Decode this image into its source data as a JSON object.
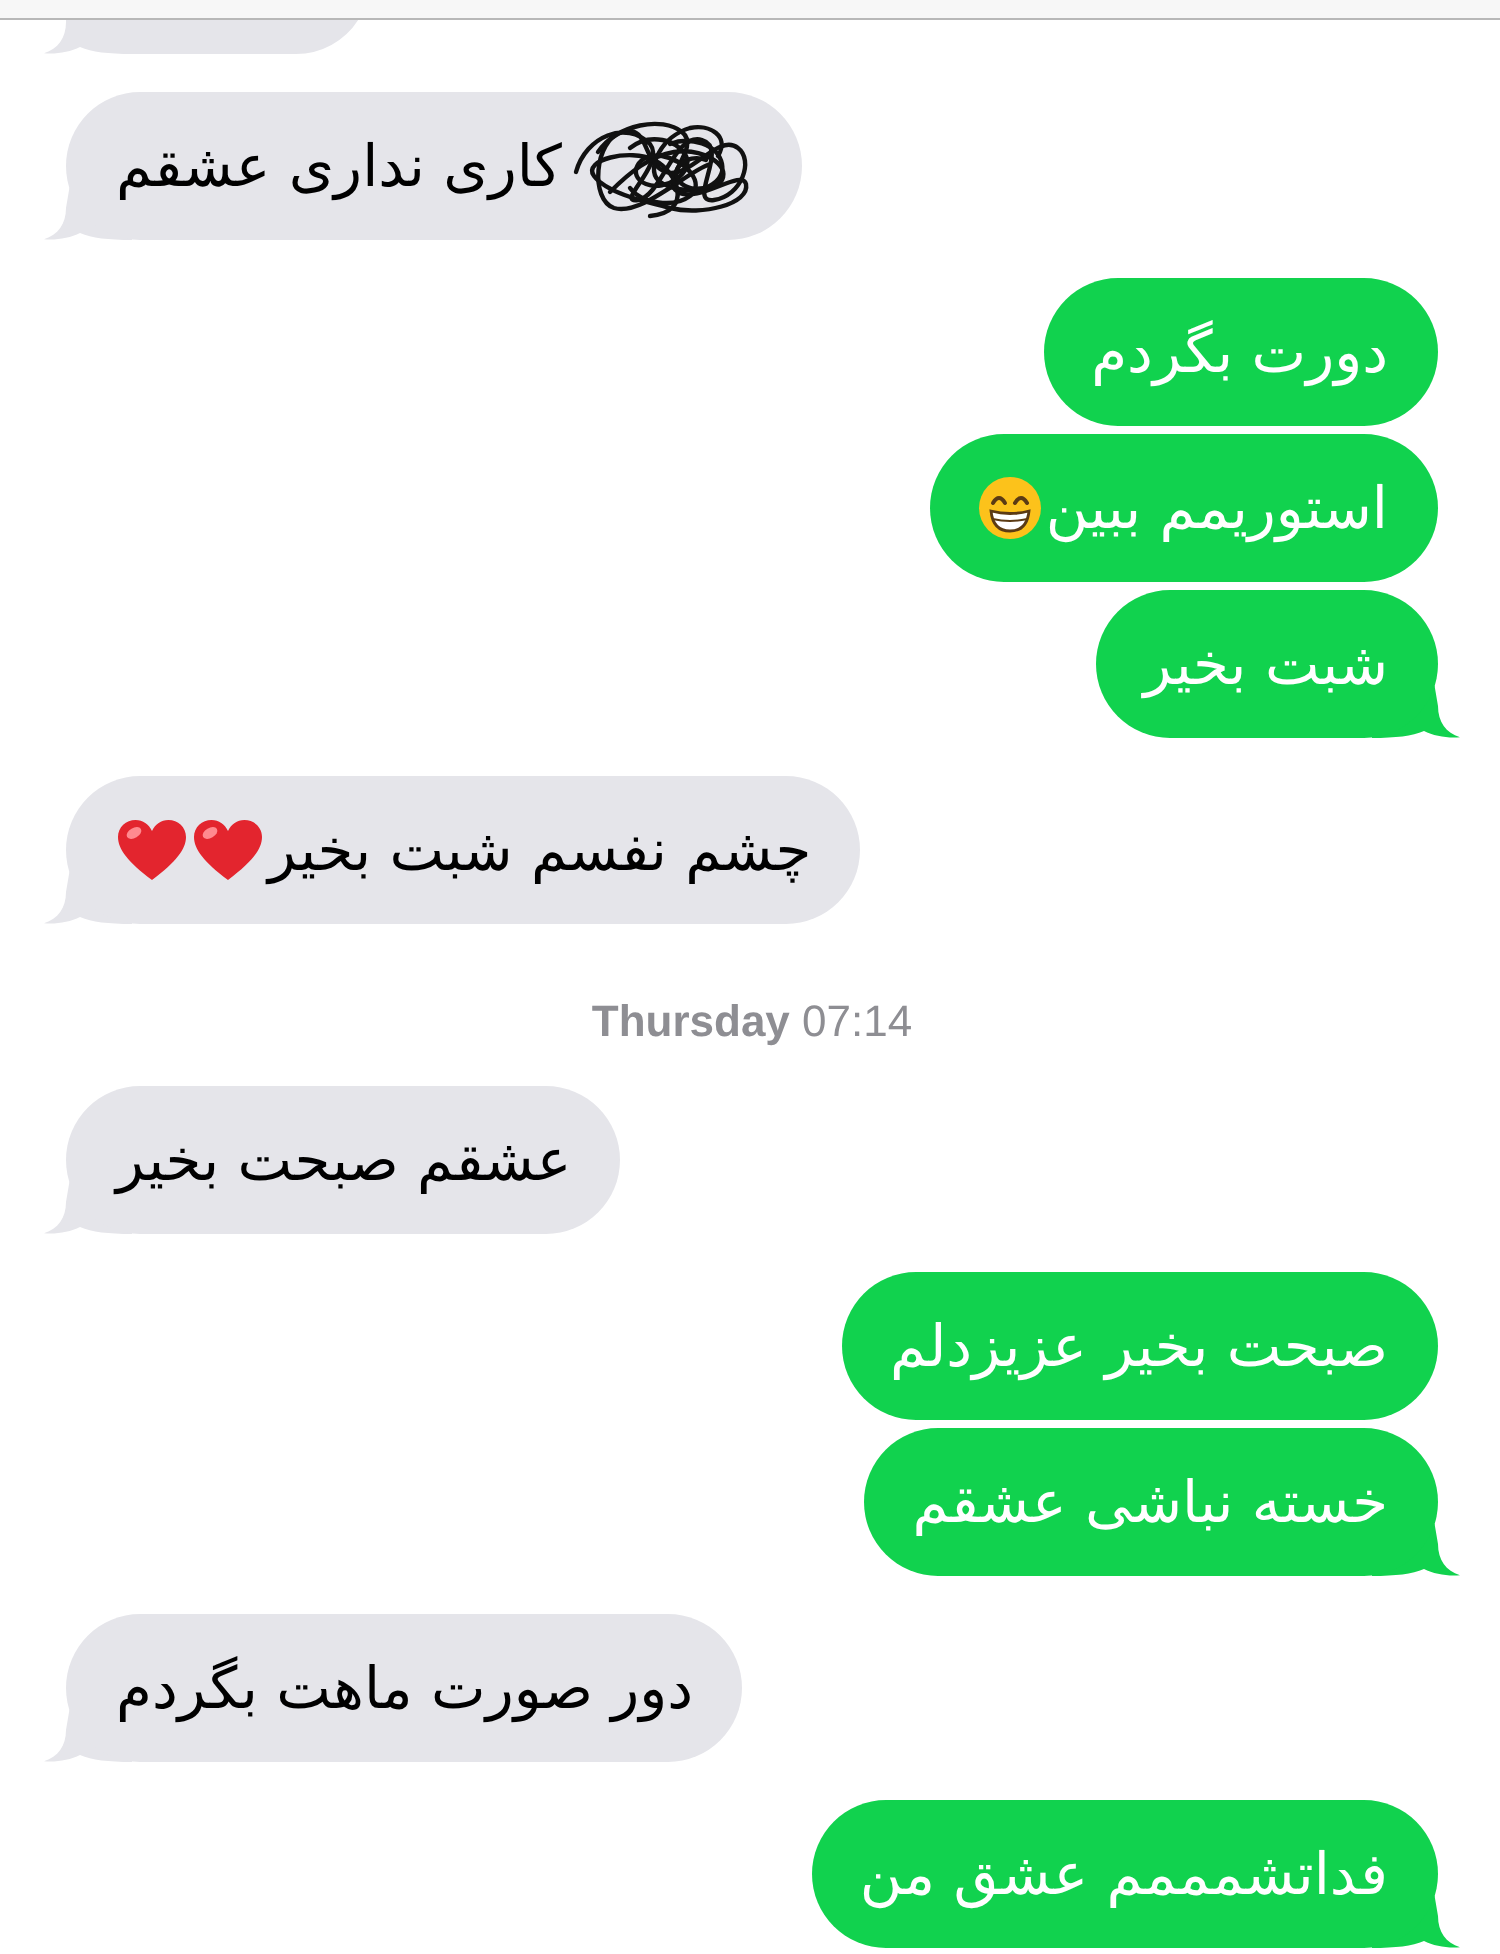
{
  "messages": [
    {
      "kind": "received",
      "clipped": true,
      "tail": true,
      "redacted": false
    },
    {
      "kind": "received",
      "text": "کاری نداری عشقم",
      "clipped": false,
      "tail": true,
      "redacted": true
    },
    {
      "kind": "sent",
      "text": "دورت بگردم",
      "clipped": false,
      "tail": false,
      "redacted": false
    },
    {
      "kind": "sent",
      "text": "استوریمم ببین",
      "clipped": false,
      "tail": false,
      "redacted": false,
      "emoji": [
        {
          "kind": "grin"
        }
      ]
    },
    {
      "kind": "sent",
      "text": "شبت بخیر",
      "clipped": false,
      "tail": true,
      "redacted": false
    },
    {
      "kind": "received",
      "text": "چشم نفسم شبت بخیر",
      "clipped": false,
      "tail": true,
      "redacted": false,
      "emoji": [
        {
          "kind": "heart"
        },
        {
          "kind": "heart"
        }
      ]
    },
    {
      "kind": "timestamp",
      "text": "**Thursday** 07:14"
    },
    {
      "kind": "received",
      "text": "عشقم صبحت بخیر",
      "clipped": false,
      "tail": true,
      "redacted": false
    },
    {
      "kind": "sent",
      "text": "صبحت بخیر عزیزدلم",
      "clipped": false,
      "tail": false,
      "redacted": false
    },
    {
      "kind": "sent",
      "text": "خسته نباشی عشقم",
      "clipped": false,
      "tail": true,
      "redacted": false
    },
    {
      "kind": "received",
      "text": "دور صورت ماهت بگردم",
      "clipped": false,
      "tail": true,
      "redacted": false
    },
    {
      "kind": "sent",
      "text": "فداتشمممم عشق من",
      "clipped": false,
      "tail": true,
      "redacted": false
    }
  ]
}
